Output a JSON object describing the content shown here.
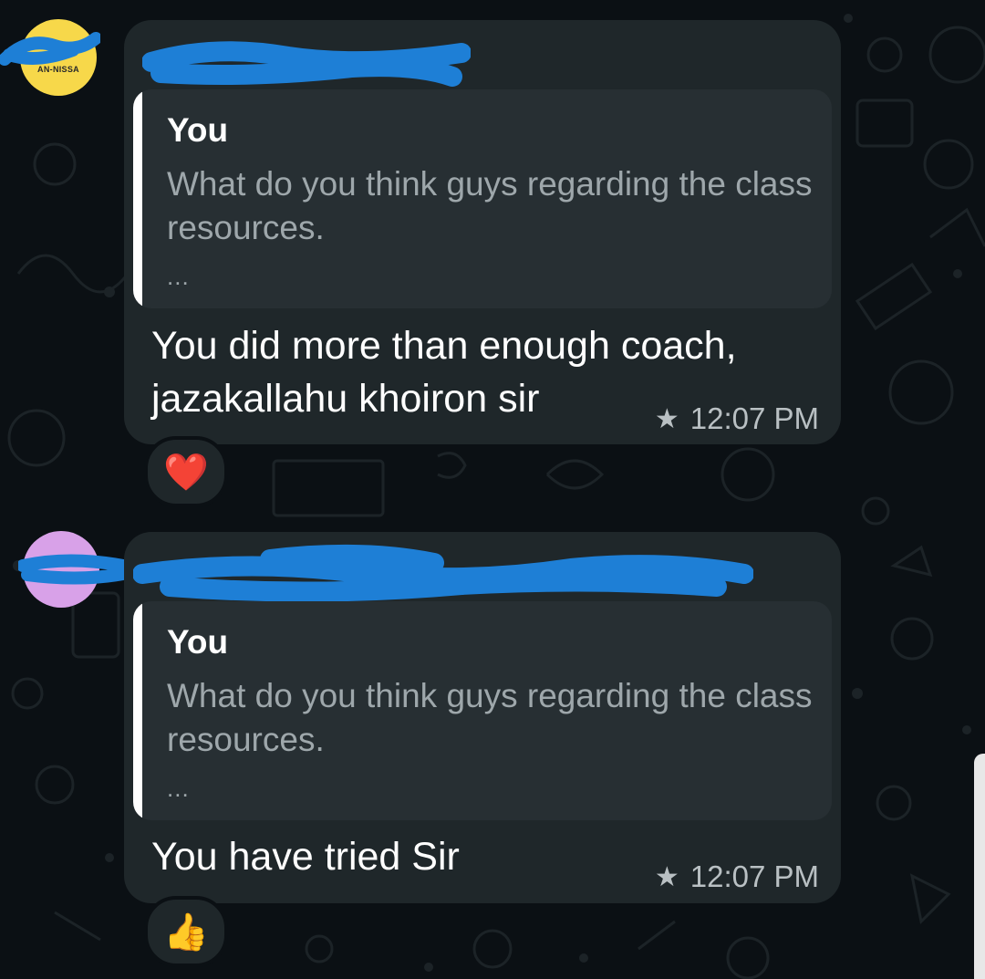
{
  "messages": [
    {
      "avatar_text": "AN-NISSA",
      "quote": {
        "author": "You",
        "text": "What do you think guys regarding the class resources.",
        "more": "..."
      },
      "text_line1": "You did more than enough coach,",
      "text_line2": "jazakallahu khoiron sir",
      "time": "12:07 PM",
      "starred_icon": "star-icon",
      "reaction": "❤️"
    },
    {
      "quote": {
        "author": "You",
        "text": "What do you think guys regarding the class resources.",
        "more": "..."
      },
      "text_line1": "You have tried Sir",
      "time": "12:07 PM",
      "starred_icon": "star-icon",
      "reaction": "👍"
    }
  ],
  "colors": {
    "background": "#0b1014",
    "bubble": "#1f272a",
    "quote_bg": "#272f33",
    "sender1": "#8bc34a",
    "sender2": "#d38ce8",
    "redaction": "#1e7fd6"
  }
}
